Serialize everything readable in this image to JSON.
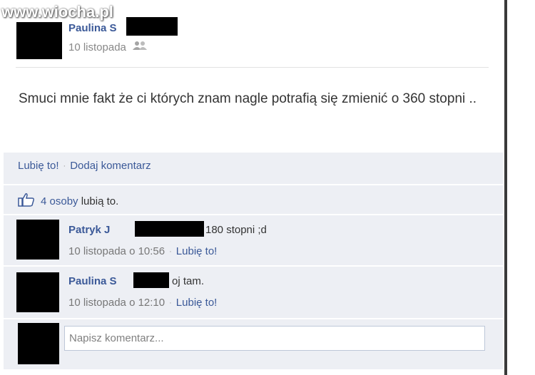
{
  "watermark": "www.wiocha.pl",
  "post": {
    "author": "Paulina S",
    "date": "10 listopada",
    "privacy_icon": "friends-icon",
    "text": "Smuci mnie fakt że ci których znam nagle potrafią się zmienić o 360 stopni .."
  },
  "actions": {
    "like": "Lubię to!",
    "comment": "Dodaj komentarz"
  },
  "likes": {
    "icon": "thumbs-up-icon",
    "count_link": "4 osoby",
    "suffix": "lubią to."
  },
  "comments": [
    {
      "author": "Patryk J",
      "text": "180 stopni ;d",
      "time": "10 listopada o 10:56",
      "like": "Lubię to!"
    },
    {
      "author": "Paulina S",
      "text": "oj tam.",
      "time": "10 listopada o 12:10",
      "like": "Lubię to!"
    }
  ],
  "composer": {
    "placeholder": "Napisz komentarz..."
  },
  "colors": {
    "link": "#3b5998",
    "panel": "#edeff4",
    "muted": "#888888"
  }
}
